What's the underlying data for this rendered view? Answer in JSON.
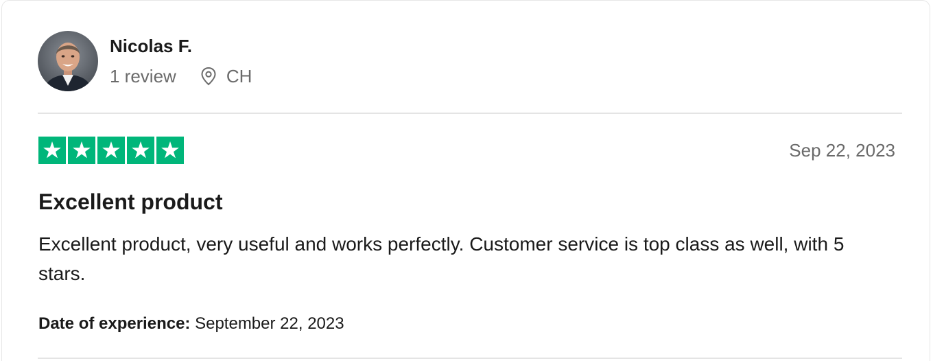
{
  "reviewer": {
    "name": "Nicolas F.",
    "review_count": "1 review",
    "location": "CH",
    "avatar_icon": "reviewer-photo",
    "location_icon": "map-pin-icon"
  },
  "review": {
    "rating": 5,
    "max_rating": 5,
    "star_color": "#00b67a",
    "date": "Sep 22, 2023",
    "title": "Excellent product",
    "body": "Excellent product, very useful and works perfectly. Customer service is top class as well, with 5 stars.",
    "experience_label": "Date of experience:",
    "experience_date": "September 22, 2023"
  }
}
